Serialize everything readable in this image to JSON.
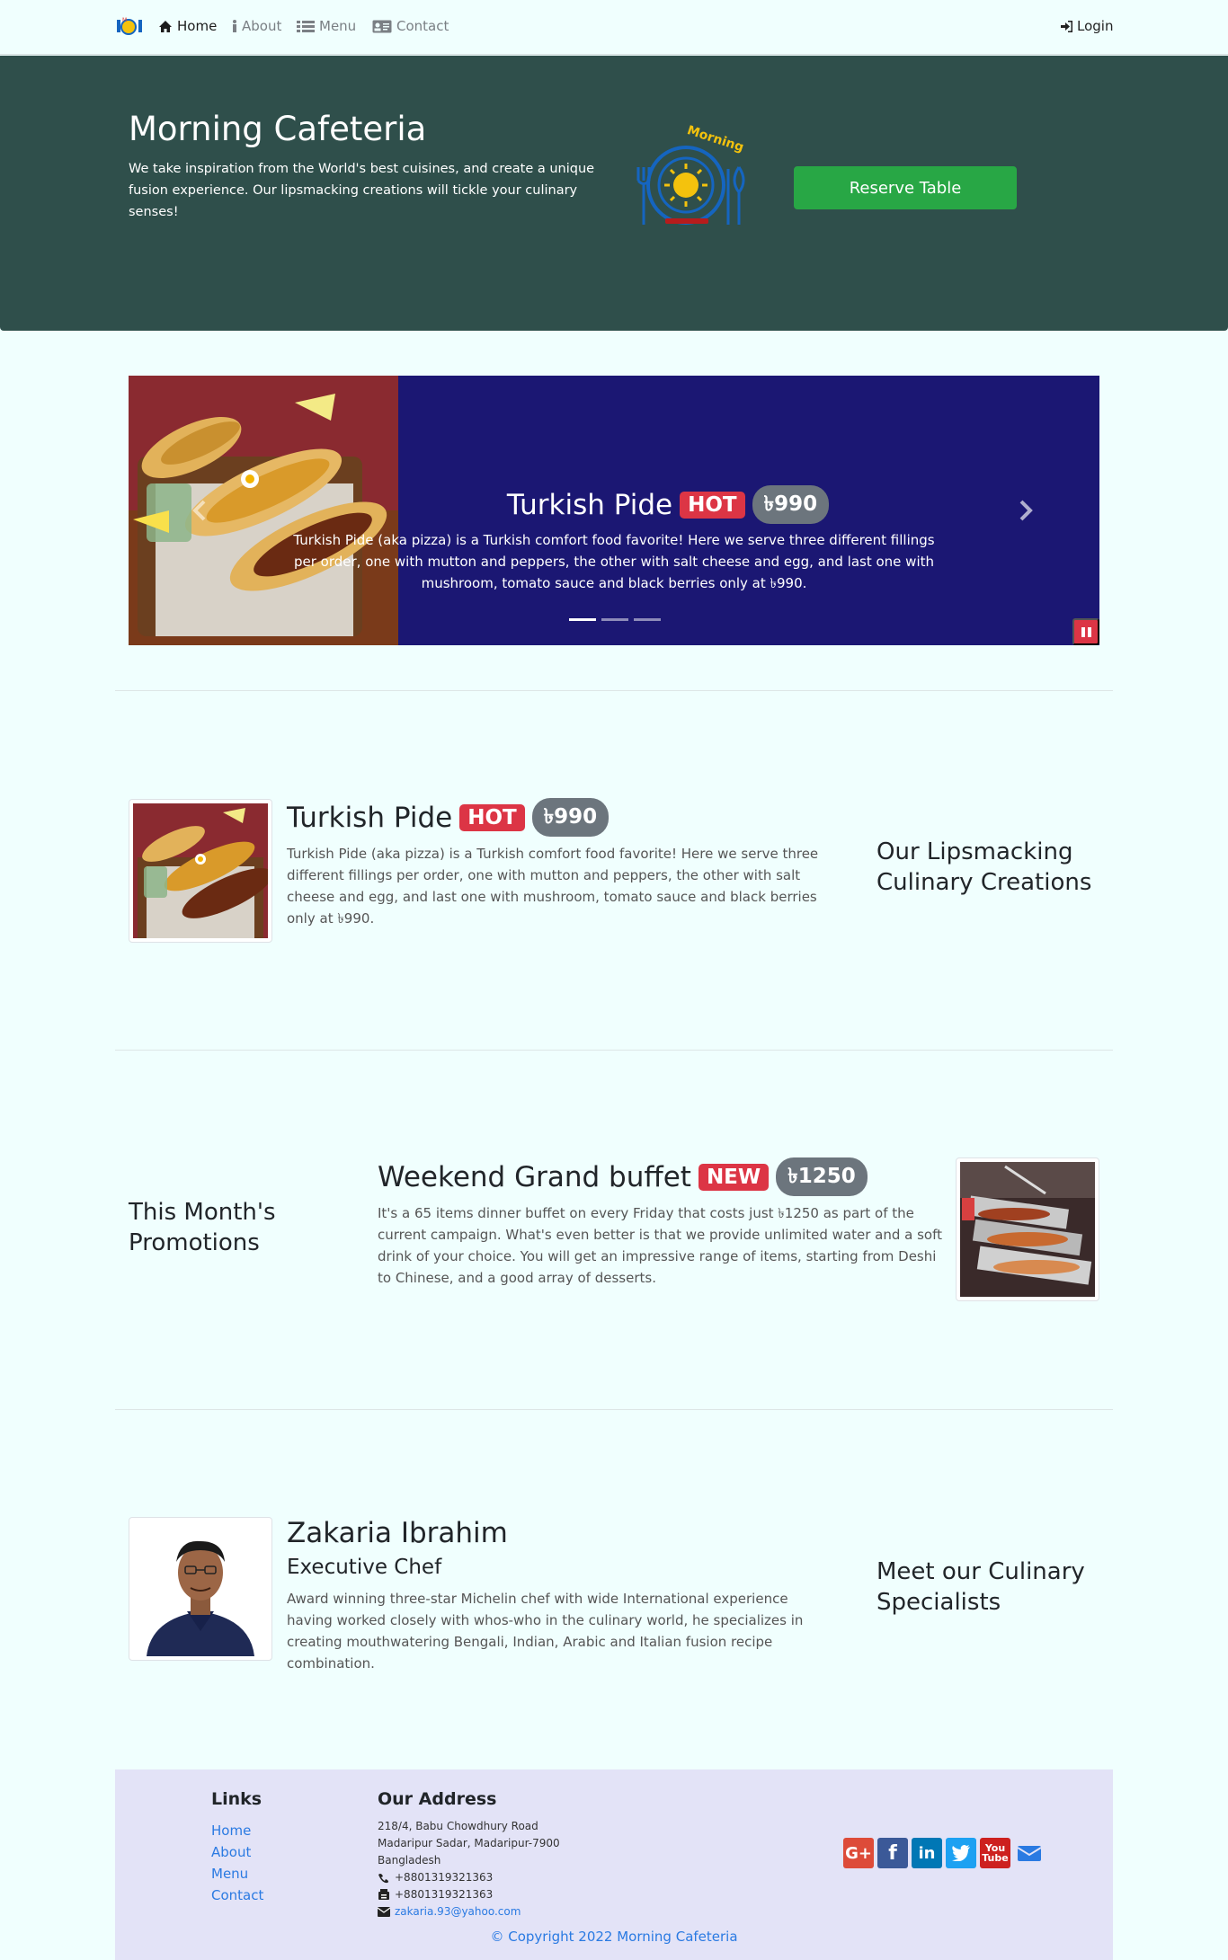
{
  "nav": {
    "home": "Home",
    "about": "About",
    "menu": "Menu",
    "contact": "Contact",
    "login": "Login"
  },
  "jumbotron": {
    "title": "Morning Cafeteria",
    "description": "We take inspiration from the World's best cuisines, and create a unique fusion experience. Our lipsmacking creations will tickle your culinary senses!",
    "logo_text": "Morning",
    "reserve_label": "Reserve Table"
  },
  "carousel": {
    "title": "Turkish Pide",
    "badge": "HOT",
    "price": "৳990",
    "text": "Turkish Pide (aka pizza) is a Turkish comfort food favorite! Here we serve three different fillings per order, one with mutton and peppers, the other with salt cheese and egg, and last one with mushroom, tomato sauce and black berries only at ৳990.",
    "active_index": 0,
    "slide_count": 3
  },
  "dish": {
    "title": "Turkish Pide",
    "badge": "HOT",
    "price": "৳990",
    "text": "Turkish Pide (aka pizza) is a Turkish comfort food favorite! Here we serve three different fillings per order, one with mutton and peppers, the other with salt cheese and egg, and last one with mushroom, tomato sauce and black berries only at ৳990.",
    "side_heading": "Our Lipsmacking Culinary Creations"
  },
  "promotion": {
    "side_heading": "This Month's Promotions",
    "title": "Weekend Grand buffet",
    "badge": "NEW",
    "price": "৳1250",
    "text": "It's a 65 items dinner buffet on every Friday that costs just ৳1250 as part of the current campaign. What's even better is that we provide unlimited water and a soft drink of your choice. You will get an impressive range of items, starting from Deshi to Chinese, and a good array of desserts."
  },
  "chef": {
    "name": "Zakaria Ibrahim",
    "role": "Executive Chef",
    "text": "Award winning three-star Michelin chef with wide International experience having worked closely with whos-who in the culinary world, he specializes in creating mouthwatering Bengali, Indian, Arabic and Italian fusion recipe combination.",
    "side_heading": "Meet our Culinary Specialists"
  },
  "footer": {
    "links_heading": "Links",
    "links": [
      "Home",
      "About",
      "Menu",
      "Contact"
    ],
    "address_heading": "Our Address",
    "address_lines": [
      "218/4, Babu Chowdhury Road",
      "Madaripur Sadar, Madaripur-7900",
      "Bangladesh"
    ],
    "phone": "+8801319321363",
    "fax": "+8801319321363",
    "email": "zakaria.93@yahoo.com",
    "copyright": "© Copyright 2022 Morning Cafeteria",
    "social": [
      "google-plus",
      "facebook",
      "linkedin",
      "twitter",
      "youtube",
      "mail"
    ]
  },
  "colors": {
    "page_bg": "#f0fffe",
    "jumbotron_bg": "#2f4f4b",
    "carousel_bg": "#1b1773",
    "success": "#28a745",
    "danger": "#dc3545",
    "secondary": "#6c757d",
    "footer_bg": "#e3e3f7",
    "link": "#2a7ae2"
  }
}
